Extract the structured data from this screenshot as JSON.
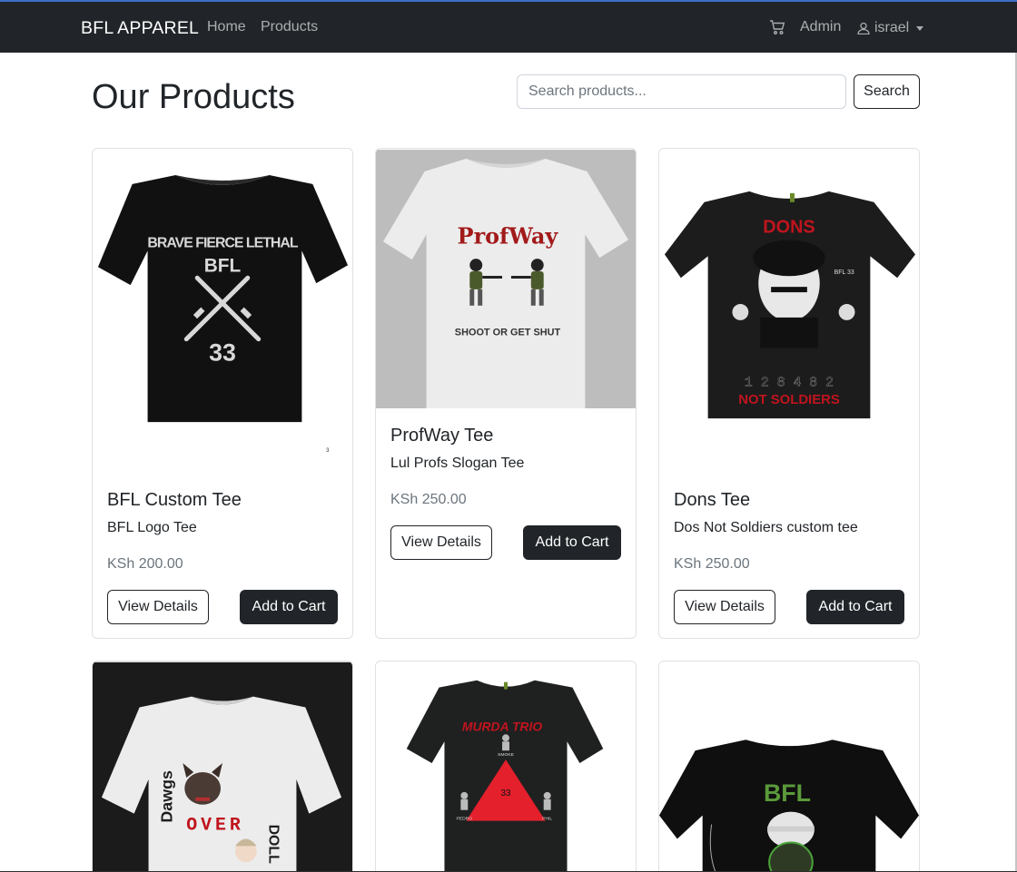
{
  "nav": {
    "brand": "BFL APPAREL",
    "home": "Home",
    "products": "Products",
    "admin": "Admin",
    "user": "israel",
    "cart_icon": "cart-icon",
    "user_icon": "user-icon"
  },
  "page": {
    "title": "Our Products",
    "search_placeholder": "Search products...",
    "search_button": "Search"
  },
  "products": [
    {
      "name": "BFL Custom Tee",
      "desc": "BFL Logo Tee",
      "price": "KSh 200.00",
      "view": "View Details",
      "add": "Add to Cart",
      "shirt_text": [
        "BRAVE FIERCE LETHAL",
        "BFL",
        "33"
      ],
      "tag": "3"
    },
    {
      "name": "ProfWay Tee",
      "desc": "Lul Profs Slogan Tee",
      "price": "KSh 250.00",
      "view": "View Details",
      "add": "Add to Cart",
      "shirt_text": [
        "ProfWay",
        "SHOOT OR GET SHUT"
      ]
    },
    {
      "name": "Dons Tee",
      "desc": "Dos Not Soldiers custom tee",
      "price": "KSh 250.00",
      "view": "View Details",
      "add": "Add to Cart",
      "shirt_text": [
        "DONS",
        "1 2 8 4 8 2",
        "NOT SOLDIERS",
        "BFL 33"
      ]
    },
    {
      "shirt_text": [
        "Dawgs",
        "OVER",
        "DOLL"
      ]
    },
    {
      "shirt_text": [
        "MURDA TRIO",
        "33",
        "SMOKE",
        "PEDRO",
        "PHIL"
      ]
    },
    {
      "shirt_text": [
        "BFL"
      ]
    }
  ],
  "colors": {
    "navbar": "#212529",
    "accent_red": "#c0141e",
    "button_dark": "#212529",
    "price": "#6c757d"
  }
}
